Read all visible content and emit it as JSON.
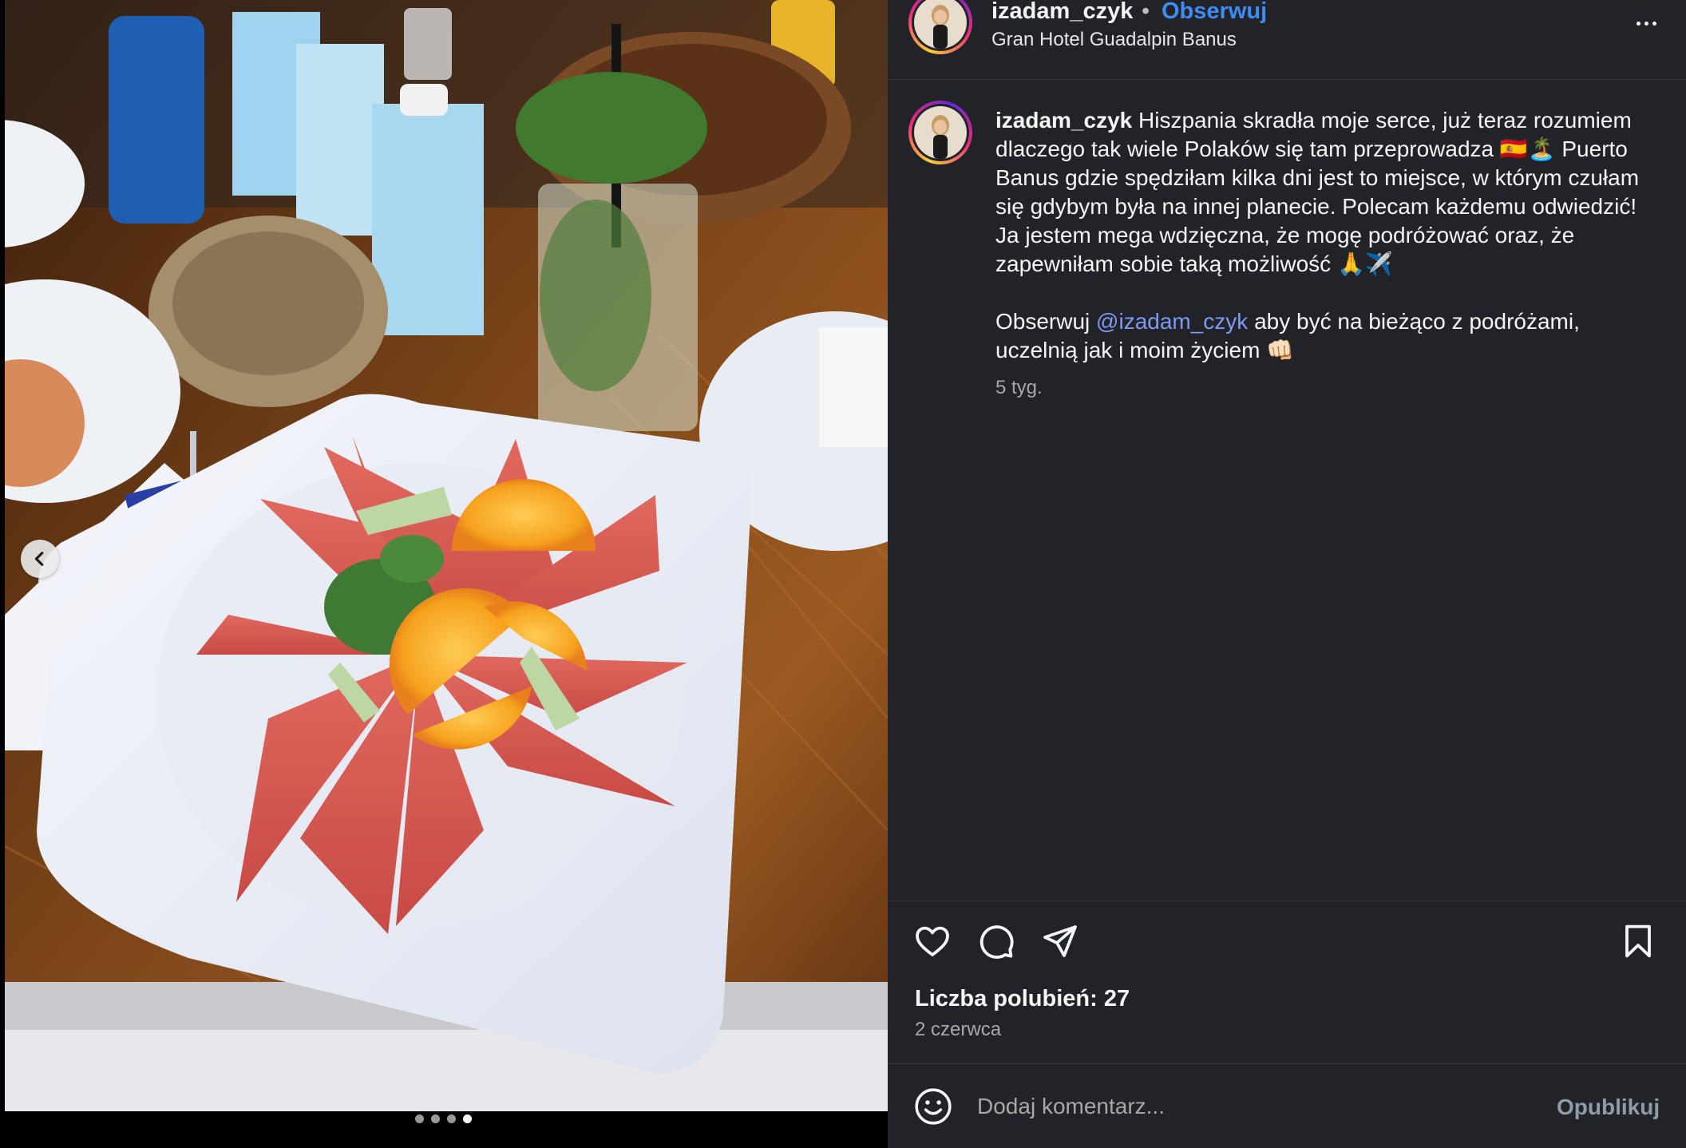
{
  "post": {
    "username": "izadam_czyk",
    "separator": "•",
    "follow_label": "Obserwuj",
    "location": "Gran Hotel Guadalpin Banus",
    "caption": {
      "username": "izadam_czyk",
      "text_1": " Hiszpania skradła moje serce, już teraz rozumiem dlaczego tak wiele Polaków się tam przeprowadza 🇪🇸🏝️ Puerto Banus gdzie spędziłam kilka dni jest to miejsce, w którym czułam się gdybym była na innej planecie. Polecam każdemu odwiedzić! Ja jestem mega wdzięczna, że mogę podróżować oraz, że zapewniłam sobie taką możliwość 🙏✈️",
      "text_2_prefix": "Obserwuj ",
      "mention": "@izadam_czyk",
      "text_2_suffix": " aby być na bieżąco z podróżami, uczelnią jak i moim życiem 👊🏻",
      "time": "5 tyg."
    },
    "likes": "Liczba polubień: 27",
    "date": "2 czerwca",
    "comment_placeholder": "Dodaj komentarz...",
    "publish_label": "Opublikuj"
  },
  "carousel": {
    "total": 4,
    "active_index": 3
  },
  "icons": {
    "prev": "chevron-left-icon",
    "more": "more-horizontal-icon",
    "like": "heart-icon",
    "comment": "comment-icon",
    "share": "send-icon",
    "save": "bookmark-icon",
    "emoji": "smiley-icon"
  },
  "colors": {
    "panel_bg": "#212328",
    "follow": "#3f8cf5",
    "mention": "#7e9af2",
    "muted": "#a8a8a8"
  }
}
